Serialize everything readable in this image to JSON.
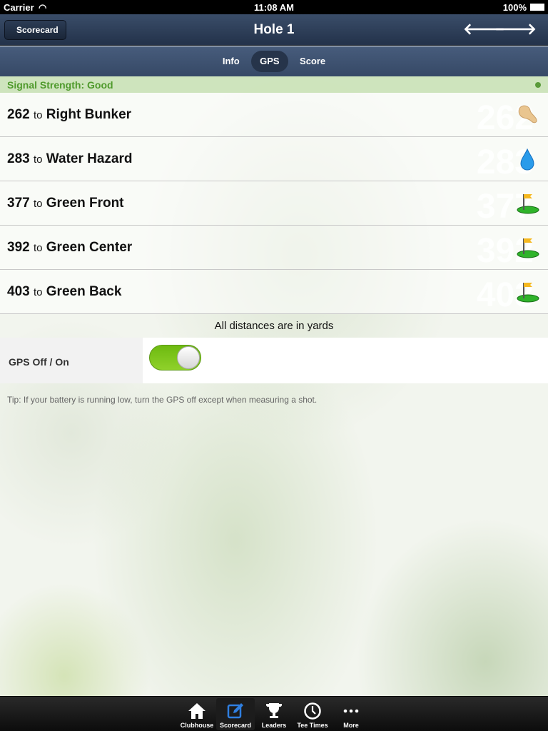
{
  "status": {
    "carrier": "Carrier",
    "time": "11:08 AM",
    "battery": "100%"
  },
  "nav": {
    "back": "Scorecard",
    "title": "Hole 1",
    "prev_icon": "arrow-left-icon",
    "next_icon": "arrow-right-icon"
  },
  "segments": [
    {
      "label": "Info"
    },
    {
      "label": "GPS",
      "selected": true
    },
    {
      "label": "Score"
    }
  ],
  "signal": {
    "text": "Signal Strength: Good",
    "color": "#4f9a2c"
  },
  "distances": [
    {
      "yards": "262",
      "to": "to",
      "target": "Right Bunker",
      "icon": "bunker-icon"
    },
    {
      "yards": "283",
      "to": "to",
      "target": "Water Hazard",
      "icon": "water-drop-icon"
    },
    {
      "yards": "377",
      "to": "to",
      "target": "Green Front",
      "icon": "green-flag-icon"
    },
    {
      "yards": "392",
      "to": "to",
      "target": "Green Center",
      "icon": "green-flag-icon"
    },
    {
      "yards": "403",
      "to": "to",
      "target": "Green Back",
      "icon": "green-flag-icon"
    }
  ],
  "note": "All distances are in yards",
  "gps_toggle": {
    "label": "GPS Off / On",
    "on": true
  },
  "tip": "Tip: If your battery is running low, turn the GPS off except when measuring a shot.",
  "tabbar": [
    {
      "label": "Clubhouse",
      "icon": "home-icon"
    },
    {
      "label": "Scorecard",
      "icon": "scorecard-icon",
      "selected": true
    },
    {
      "label": "Leaders",
      "icon": "trophy-icon"
    },
    {
      "label": "Tee Times",
      "icon": "clock-icon"
    },
    {
      "label": "More",
      "icon": "more-icon"
    }
  ]
}
